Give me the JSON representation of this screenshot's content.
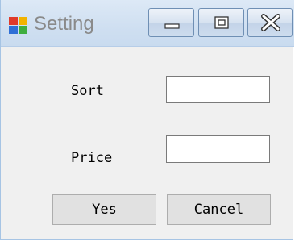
{
  "window": {
    "title": "Setting",
    "controls": {
      "minimize": "minimize-icon",
      "maximize": "maximize-icon",
      "close": "close-icon"
    },
    "icon": {
      "name": "app-icon",
      "colors": [
        "#e03a2a",
        "#f2b300",
        "#2f6fd6",
        "#3fae3f"
      ]
    }
  },
  "form": {
    "sort_label": "Sort",
    "sort_value": "",
    "price_label": "Price",
    "price_value": ""
  },
  "buttons": {
    "yes_label": "Yes",
    "cancel_label": "Cancel"
  },
  "colors": {
    "titlebar": "#cfdff1",
    "client_bg": "#f0f0f0",
    "button_bg": "#e1e1e1",
    "title_text": "#8a8a8a"
  }
}
